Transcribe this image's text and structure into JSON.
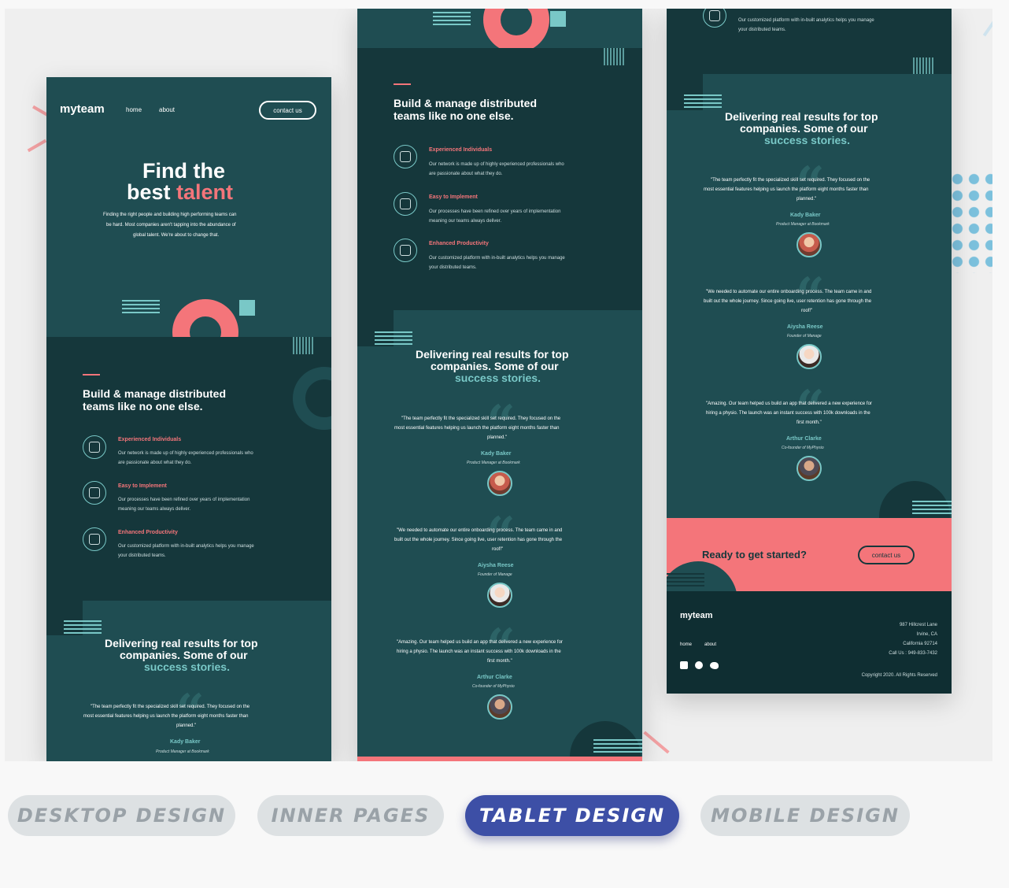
{
  "colors": {
    "panel": "#1f4d52",
    "panel_dark": "#15373b",
    "coral": "#f4757a",
    "mint": "#79c8c7",
    "active_tab": "#3d4fa6"
  },
  "site": {
    "logo": "myteam",
    "nav": {
      "home": "home",
      "about": "about",
      "contact": "contact us"
    },
    "hero": {
      "line1": "Find the",
      "line2_prefix": "best ",
      "line2_accent": "talent",
      "body": [
        "Finding the right people and building high performing teams can",
        "be hard. Most companies aren't tapping into the abundance of",
        "global talent. We're about to change that."
      ]
    },
    "build": {
      "line1": "Build & manage distributed",
      "line2": "teams like no one else."
    },
    "features": [
      {
        "icon": "person-icon",
        "title": "Experienced Individuals",
        "lines": [
          "Our network is made up of highly experienced professionals who",
          "are passionate about what they do."
        ]
      },
      {
        "icon": "gear-icon",
        "title": "Easy to Implement",
        "lines": [
          "Our processes have been refined over years of implementation",
          "meaning our teams always deliver."
        ]
      },
      {
        "icon": "chart-icon",
        "title": "Enhanced Productivity",
        "lines": [
          "Our customized platform with in-built analytics helps you manage",
          "your distributed teams."
        ]
      }
    ],
    "results": {
      "line1": "Delivering real results for top",
      "line2": "companies. Some of our",
      "line3": "success stories."
    },
    "testimonials": [
      {
        "lines": [
          "\"The team perfectly fit the specialized skill set required. They focused on the",
          "most essential features helping us launch the platform eight months faster than",
          "planned.\""
        ],
        "name": "Kady Baker",
        "role": "Product Manager at Bookmark"
      },
      {
        "lines": [
          "\"We needed to automate our entire onboarding process. The team came in and",
          "built out the whole journey. Since going live, user retention has gone through the",
          "roof!\""
        ],
        "name": "Aiysha Reese",
        "role": "Founder of Manage"
      },
      {
        "lines": [
          "\"Amazing. Our team helped us build an app that delivered a new experience for",
          "hiring a physio. The launch was an instant success with 100k downloads in the",
          "first month.\""
        ],
        "name": "Arthur Clarke",
        "role": "Co-founder of MyPhysio"
      }
    ],
    "cta": {
      "title": "Ready to get started?",
      "button": "contact us"
    },
    "footer": {
      "address": [
        "987 Hillcrest Lane",
        "Irvine, CA",
        "California 92714",
        "Call Us : 949-833-7432"
      ],
      "copyright": "Copyright 2020. All Rights Reserved",
      "social": [
        "facebook-icon",
        "pinterest-icon",
        "twitter-icon"
      ]
    }
  },
  "tabs": [
    {
      "label": "DESKTOP DESIGN",
      "active": false
    },
    {
      "label": "INNER PAGES",
      "active": false
    },
    {
      "label": "TABLET DESIGN",
      "active": true
    },
    {
      "label": "MOBILE DESIGN",
      "active": false
    }
  ]
}
